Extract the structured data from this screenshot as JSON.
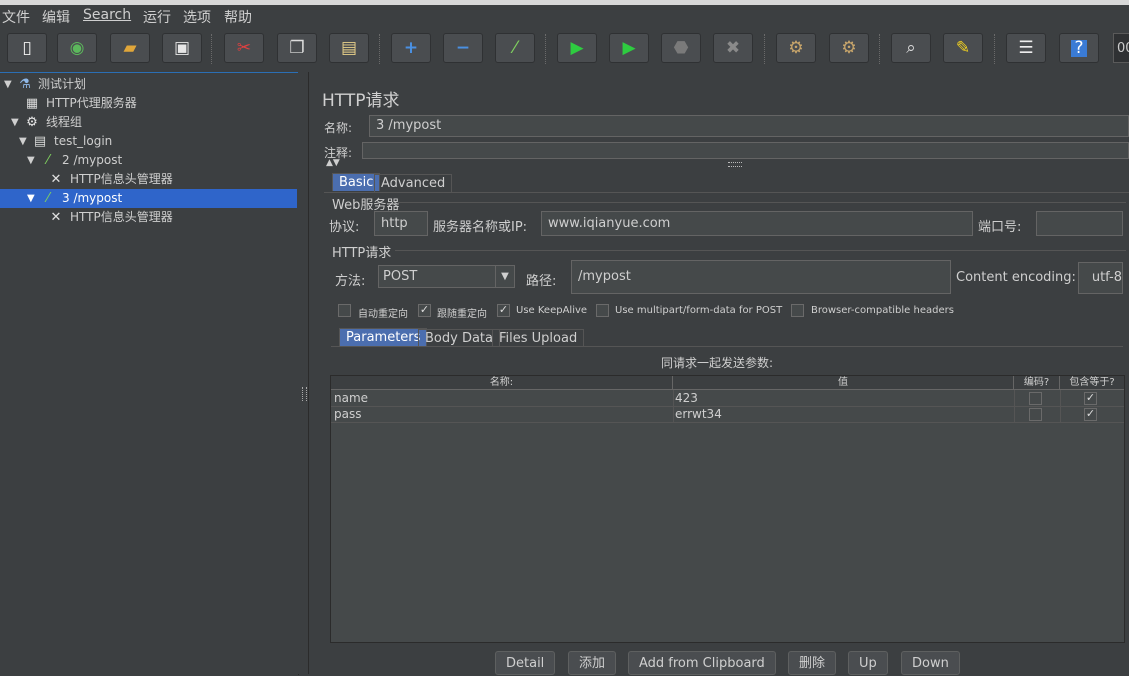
{
  "menubar": {
    "items": [
      "文件",
      "编辑",
      "Search",
      "运行",
      "选项",
      "帮助"
    ]
  },
  "toolbar": {
    "icons": [
      "new-icon",
      "templates-icon",
      "open-icon",
      "save-icon",
      "cut-icon",
      "copy-icon",
      "paste-icon",
      "expand-icon",
      "collapse-icon",
      "toggle-icon",
      "start-icon",
      "start-no-pause-icon",
      "stop-icon",
      "shutdown-icon",
      "clear-icon",
      "clear-all-icon",
      "search-icon",
      "reset-search-icon",
      "function-helper-icon",
      "help-icon"
    ],
    "end_text": "00"
  },
  "tree": {
    "items": [
      {
        "label": "测试计划",
        "icon": "flask-icon"
      },
      {
        "label": "HTTP代理服务器",
        "icon": "proxy-icon"
      },
      {
        "label": "线程组",
        "icon": "gear-icon"
      },
      {
        "label": "test_login",
        "icon": "controller-icon"
      },
      {
        "label": "2 /mypost",
        "icon": "sampler-icon"
      },
      {
        "label": "HTTP信息头管理器",
        "icon": "wrench-icon"
      },
      {
        "label": "3 /mypost",
        "icon": "sampler-icon"
      },
      {
        "label": "HTTP信息头管理器",
        "icon": "wrench-icon"
      }
    ]
  },
  "panel": {
    "title": "HTTP请求",
    "name_label": "名称:",
    "name_value": "3 /mypost",
    "comment_label": "注释:",
    "tabs": [
      "Basic",
      "Advanced"
    ],
    "web_server": {
      "group_title": "Web服务器",
      "protocol_label": "协议:",
      "protocol_value": "http",
      "server_label": "服务器名称或IP:",
      "server_value": "www.iqianyue.com",
      "port_label": "端口号:",
      "port_value": ""
    },
    "http_request": {
      "group_title": "HTTP请求",
      "method_label": "方法:",
      "method_value": "POST",
      "path_label": "路径:",
      "path_value": "/mypost",
      "encoding_label": "Content encoding:",
      "encoding_value": "utf-8"
    },
    "options": [
      {
        "label": "自动重定向",
        "checked": false
      },
      {
        "label": "跟随重定向",
        "checked": true
      },
      {
        "label": "Use KeepAlive",
        "checked": true
      },
      {
        "label": "Use multipart/form-data for POST",
        "checked": false
      },
      {
        "label": "Browser-compatible headers",
        "checked": false
      }
    ],
    "sub_tabs": [
      "Parameters",
      "Body Data",
      "Files Upload"
    ],
    "params_caption": "同请求一起发送参数:",
    "table": {
      "headers": [
        "名称:",
        "值",
        "编码?",
        "包含等于?"
      ],
      "rows": [
        {
          "name": "name",
          "value": "423",
          "encode": false,
          "include_equals": true
        },
        {
          "name": "pass",
          "value": "errwt34",
          "encode": false,
          "include_equals": true
        }
      ]
    },
    "buttons": [
      "Detail",
      "添加",
      "Add from Clipboard",
      "删除",
      "Up",
      "Down"
    ]
  }
}
